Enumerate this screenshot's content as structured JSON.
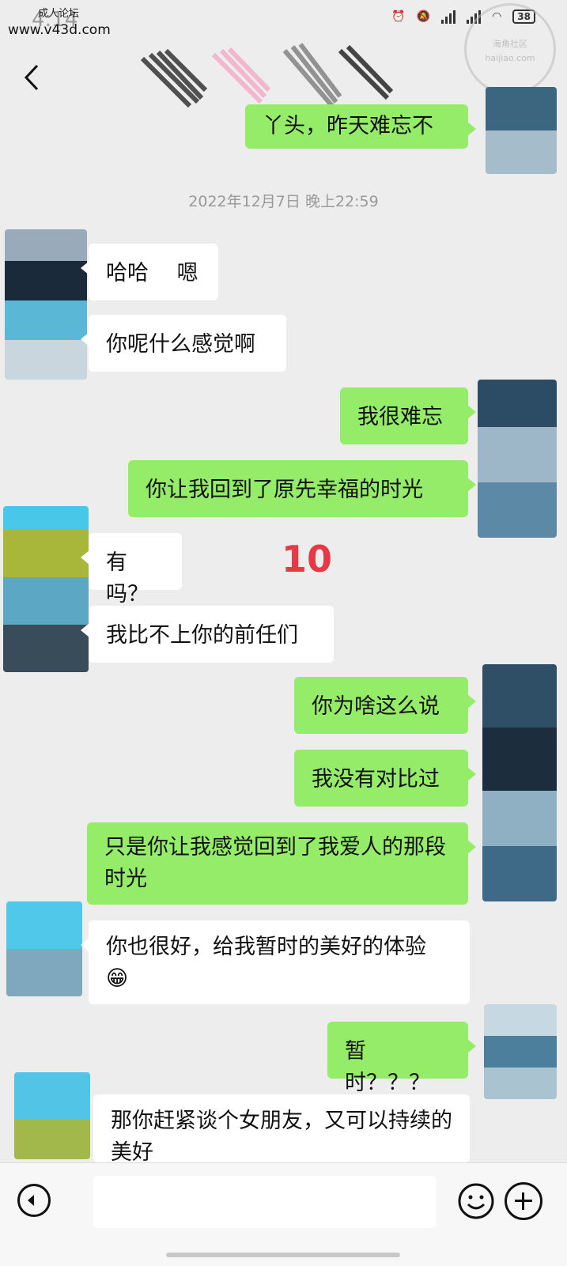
{
  "watermark": {
    "top_label": "成人论坛",
    "url": "www.v43d.com",
    "stamp_text": "haijiao.com",
    "stamp_label": "海角社区"
  },
  "status": {
    "time": "4:14",
    "battery": "38"
  },
  "timestamp": "2022年12月7日 晚上22:59",
  "messages": [
    {
      "dir": "out",
      "text": "丫头，昨天难忘不"
    },
    {
      "dir": "in",
      "text": "哈哈　 嗯"
    },
    {
      "dir": "in",
      "text": "你呢什么感觉啊"
    },
    {
      "dir": "out",
      "text": "我很难忘"
    },
    {
      "dir": "out",
      "text": "你让我回到了原先幸福的时光"
    },
    {
      "dir": "in",
      "text": "有吗？"
    },
    {
      "dir": "in",
      "text": "我比不上你的前任们"
    },
    {
      "dir": "out",
      "text": "你为啥这么说"
    },
    {
      "dir": "out",
      "text": "我没有对比过"
    },
    {
      "dir": "out",
      "text": "只是你让我感觉回到了我爱人的那段时光"
    },
    {
      "dir": "in",
      "text": "你也很好，给我暂时的美好的体验",
      "emoji": "😁"
    },
    {
      "dir": "out",
      "text": "暂时？？？"
    },
    {
      "dir": "in",
      "text": "那你赶紧谈个女朋友，又可以持续的美好"
    }
  ],
  "overlay_number": "10",
  "colors": {
    "outgoing": "#95ec69",
    "incoming": "#ffffff",
    "background": "#ededed",
    "overlay": "#e63946"
  },
  "icons": {
    "back": "chevron-left-icon",
    "voice": "voice-input-icon",
    "emoji": "emoji-icon",
    "more": "plus-icon"
  }
}
